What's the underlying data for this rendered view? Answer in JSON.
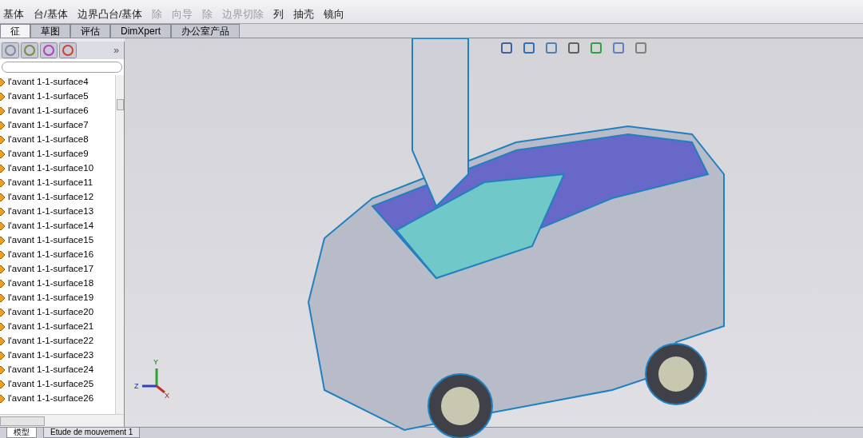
{
  "toolbar": {
    "items": [
      {
        "label": "基体",
        "disabled": false
      },
      {
        "label": "台/基体",
        "disabled": false
      },
      {
        "label": "边界凸台/基体",
        "disabled": false
      },
      {
        "label": "除",
        "disabled": true
      },
      {
        "label": "向导",
        "disabled": true
      },
      {
        "label": "除",
        "disabled": true
      },
      {
        "label": "边界切除",
        "disabled": true
      },
      {
        "label": "列",
        "disabled": false
      },
      {
        "label": "抽壳",
        "disabled": false
      },
      {
        "label": "镜向",
        "disabled": false
      }
    ]
  },
  "command_tabs": [
    {
      "label": "征",
      "selected": true
    },
    {
      "label": "草图",
      "selected": false
    },
    {
      "label": "评估",
      "selected": false
    },
    {
      "label": "DimXpert",
      "selected": false
    },
    {
      "label": "办公室产品",
      "selected": false
    }
  ],
  "panel": {
    "overflow": "»",
    "tree_items": [
      "l'avant 1-1-surface4",
      "l'avant 1-1-surface5",
      "l'avant 1-1-surface6",
      "l'avant 1-1-surface7",
      "l'avant 1-1-surface8",
      "l'avant 1-1-surface9",
      "l'avant 1-1-surface10",
      "l'avant 1-1-surface11",
      "l'avant 1-1-surface12",
      "l'avant 1-1-surface13",
      "l'avant 1-1-surface14",
      "l'avant 1-1-surface15",
      "l'avant 1-1-surface16",
      "l'avant 1-1-surface17",
      "l'avant 1-1-surface18",
      "l'avant 1-1-surface19",
      "l'avant 1-1-surface20",
      "l'avant 1-1-surface21",
      "l'avant 1-1-surface22",
      "l'avant 1-1-surface23",
      "l'avant 1-1-surface24",
      "l'avant 1-1-surface25",
      "l'avant 1-1-surface26"
    ]
  },
  "axes": {
    "y": "Y",
    "z": "Z",
    "x": "X"
  },
  "bottom_tabs": [
    {
      "label": "模型",
      "selected": true
    },
    {
      "label": "Etude de mouvement 1",
      "selected": false
    }
  ]
}
